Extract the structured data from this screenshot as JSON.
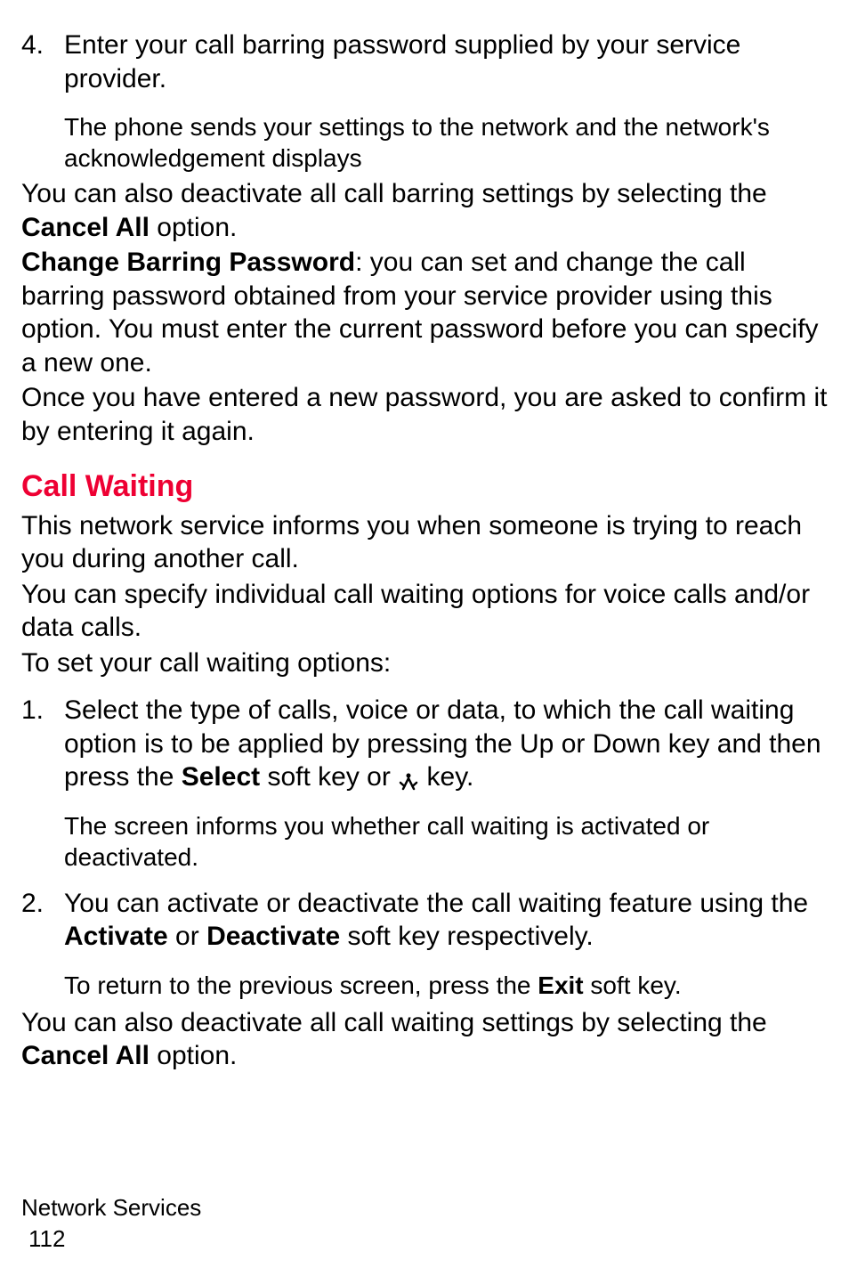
{
  "step4": {
    "num": "4.",
    "text_a": "Enter your call barring password supplied by your service provider.",
    "sub": "The phone sends your settings to the network and the network's acknowledgement displays"
  },
  "para1_a": "You can also deactivate all call barring settings by selecting the ",
  "para1_bold": "Cancel All",
  "para1_b": " option.",
  "para2_bold": "Change Barring Password",
  "para2_a": ": you can set and change the call barring password obtained from your service provider using this option. You must enter the current password before you can specify a new one.",
  "para3": "Once you have entered a new password, you are asked to confirm it by entering it again.",
  "heading": "Call Waiting",
  "cw_para1": "This network service informs you when someone is trying to reach you during another call.",
  "cw_para2": "You can specify individual call waiting options for voice calls and/or data calls.",
  "cw_para3": "To set your call waiting options:",
  "cw_step1": {
    "num": "1.",
    "text_a": "Select the type of calls, voice or data, to which the call waiting option is to be applied by pressing the Up or Down key and then press the ",
    "bold1": "Select",
    "text_b": " soft key or ",
    "text_c": " key.",
    "sub": "The screen informs you whether call waiting is activated or deactivated."
  },
  "cw_step2": {
    "num": "2.",
    "text_a": "You can activate or deactivate the call waiting feature using the ",
    "bold1": "Activate",
    "text_b": " or ",
    "bold2": "Deactivate",
    "text_c": " soft key respectively.",
    "sub_a": "To return to the previous screen, press the ",
    "sub_bold": "Exit",
    "sub_b": " soft key."
  },
  "cw_para4_a": "You can also deactivate all call waiting settings by selecting the ",
  "cw_para4_bold": "Cancel All",
  "cw_para4_b": " option.",
  "footer_section": "Network Services",
  "footer_page": "112"
}
